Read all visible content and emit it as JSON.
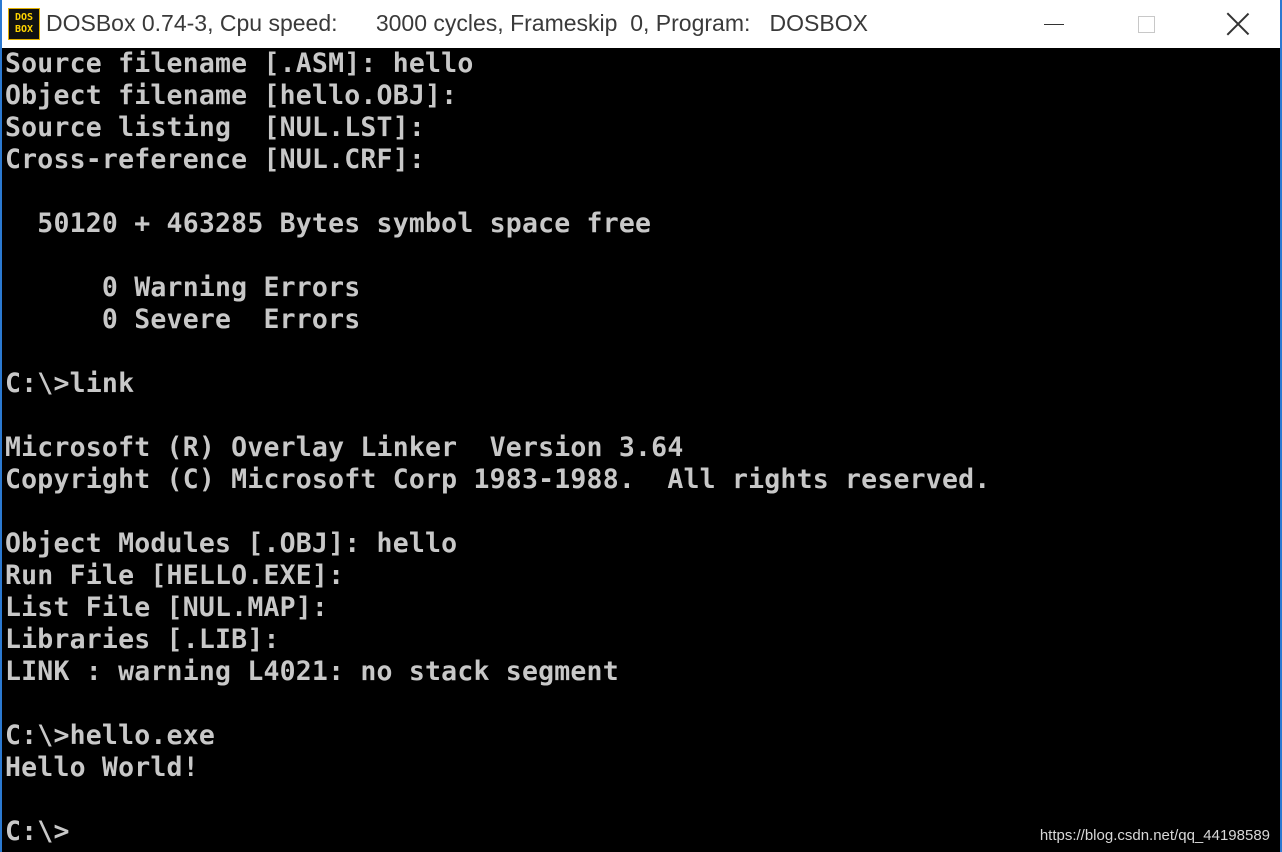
{
  "window": {
    "title": "DOSBox 0.74-3, Cpu speed:      3000 cycles, Frameskip  0, Program:   DOSBOX",
    "icon_line1": "DOS",
    "icon_line2": "BOX",
    "icon_name": "dosbox-icon",
    "controls": [
      "minimize-icon",
      "maximize-icon",
      "close-icon"
    ]
  },
  "terminal": {
    "lines": [
      "Source filename [.ASM]: hello",
      "Object filename [hello.OBJ]:",
      "Source listing  [NUL.LST]:",
      "Cross-reference [NUL.CRF]:",
      "",
      "  50120 + 463285 Bytes symbol space free",
      "",
      "      0 Warning Errors",
      "      0 Severe  Errors",
      "",
      "C:\\>link",
      "",
      "Microsoft (R) Overlay Linker  Version 3.64",
      "Copyright (C) Microsoft Corp 1983-1988.  All rights reserved.",
      "",
      "Object Modules [.OBJ]: hello",
      "Run File [HELLO.EXE]:",
      "List File [NUL.MAP]:",
      "Libraries [.LIB]:",
      "LINK : warning L4021: no stack segment",
      "",
      "C:\\>hello.exe",
      "Hello World!",
      "",
      "C:\\>"
    ]
  },
  "watermark": "https://blog.csdn.net/qq_44198589",
  "colors": {
    "terminal_bg": "#000000",
    "terminal_fg": "#c8c8c8",
    "window_border": "#2b79d1",
    "titlebar_bg": "#ffffff"
  }
}
